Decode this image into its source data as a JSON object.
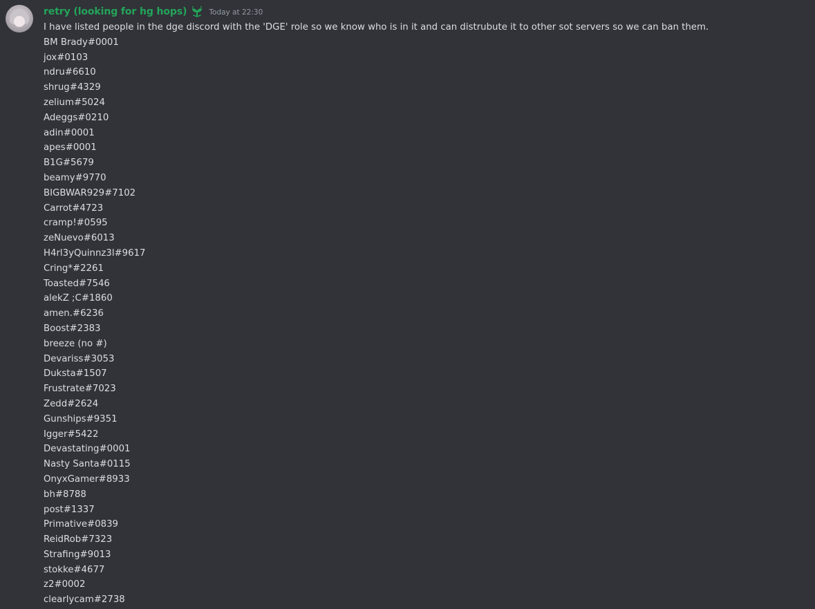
{
  "message": {
    "author": "retry (looking for hg hops)",
    "author_color": "#23a55a",
    "role_icon": "sprout-icon",
    "timestamp": "Today at 22:30",
    "intro": "I have listed people in the dge discord with the 'DGE' role so we know who is in it and can distrubute it to other sot servers so we can ban them.",
    "lines": [
      "BM Brady#0001",
      "jox#0103",
      "ndru#6610",
      "shrug#4329",
      "zelium#5024",
      "Adeggs#0210",
      "adin#0001",
      "apes#0001",
      "B1G#5679",
      "beamy#9770",
      "BIGBWAR929#7102",
      "Carrot#4723",
      "cramp!#0595",
      "zeNuevo#6013",
      "H4rl3yQuinnz3l#9617",
      "Cring*#2261",
      "Toasted#7546",
      "alekZ ;C#1860",
      "amen.#6236",
      "Boost#2383",
      "breeze (no #)",
      "Devariss#3053",
      "Duksta#1507",
      "Frustrate#7023",
      "Zedd#2624",
      "Gunships#9351",
      "Igger#5422",
      "Devastating#0001",
      "Nasty Santa#0115",
      "OnyxGamer#8933",
      "bh#8788",
      "post#1337",
      "Primative#0839",
      "ReidRob#7323",
      "Strafing#9013",
      "stokke#4677",
      "z2#0002",
      "clearlycam#2738"
    ]
  }
}
